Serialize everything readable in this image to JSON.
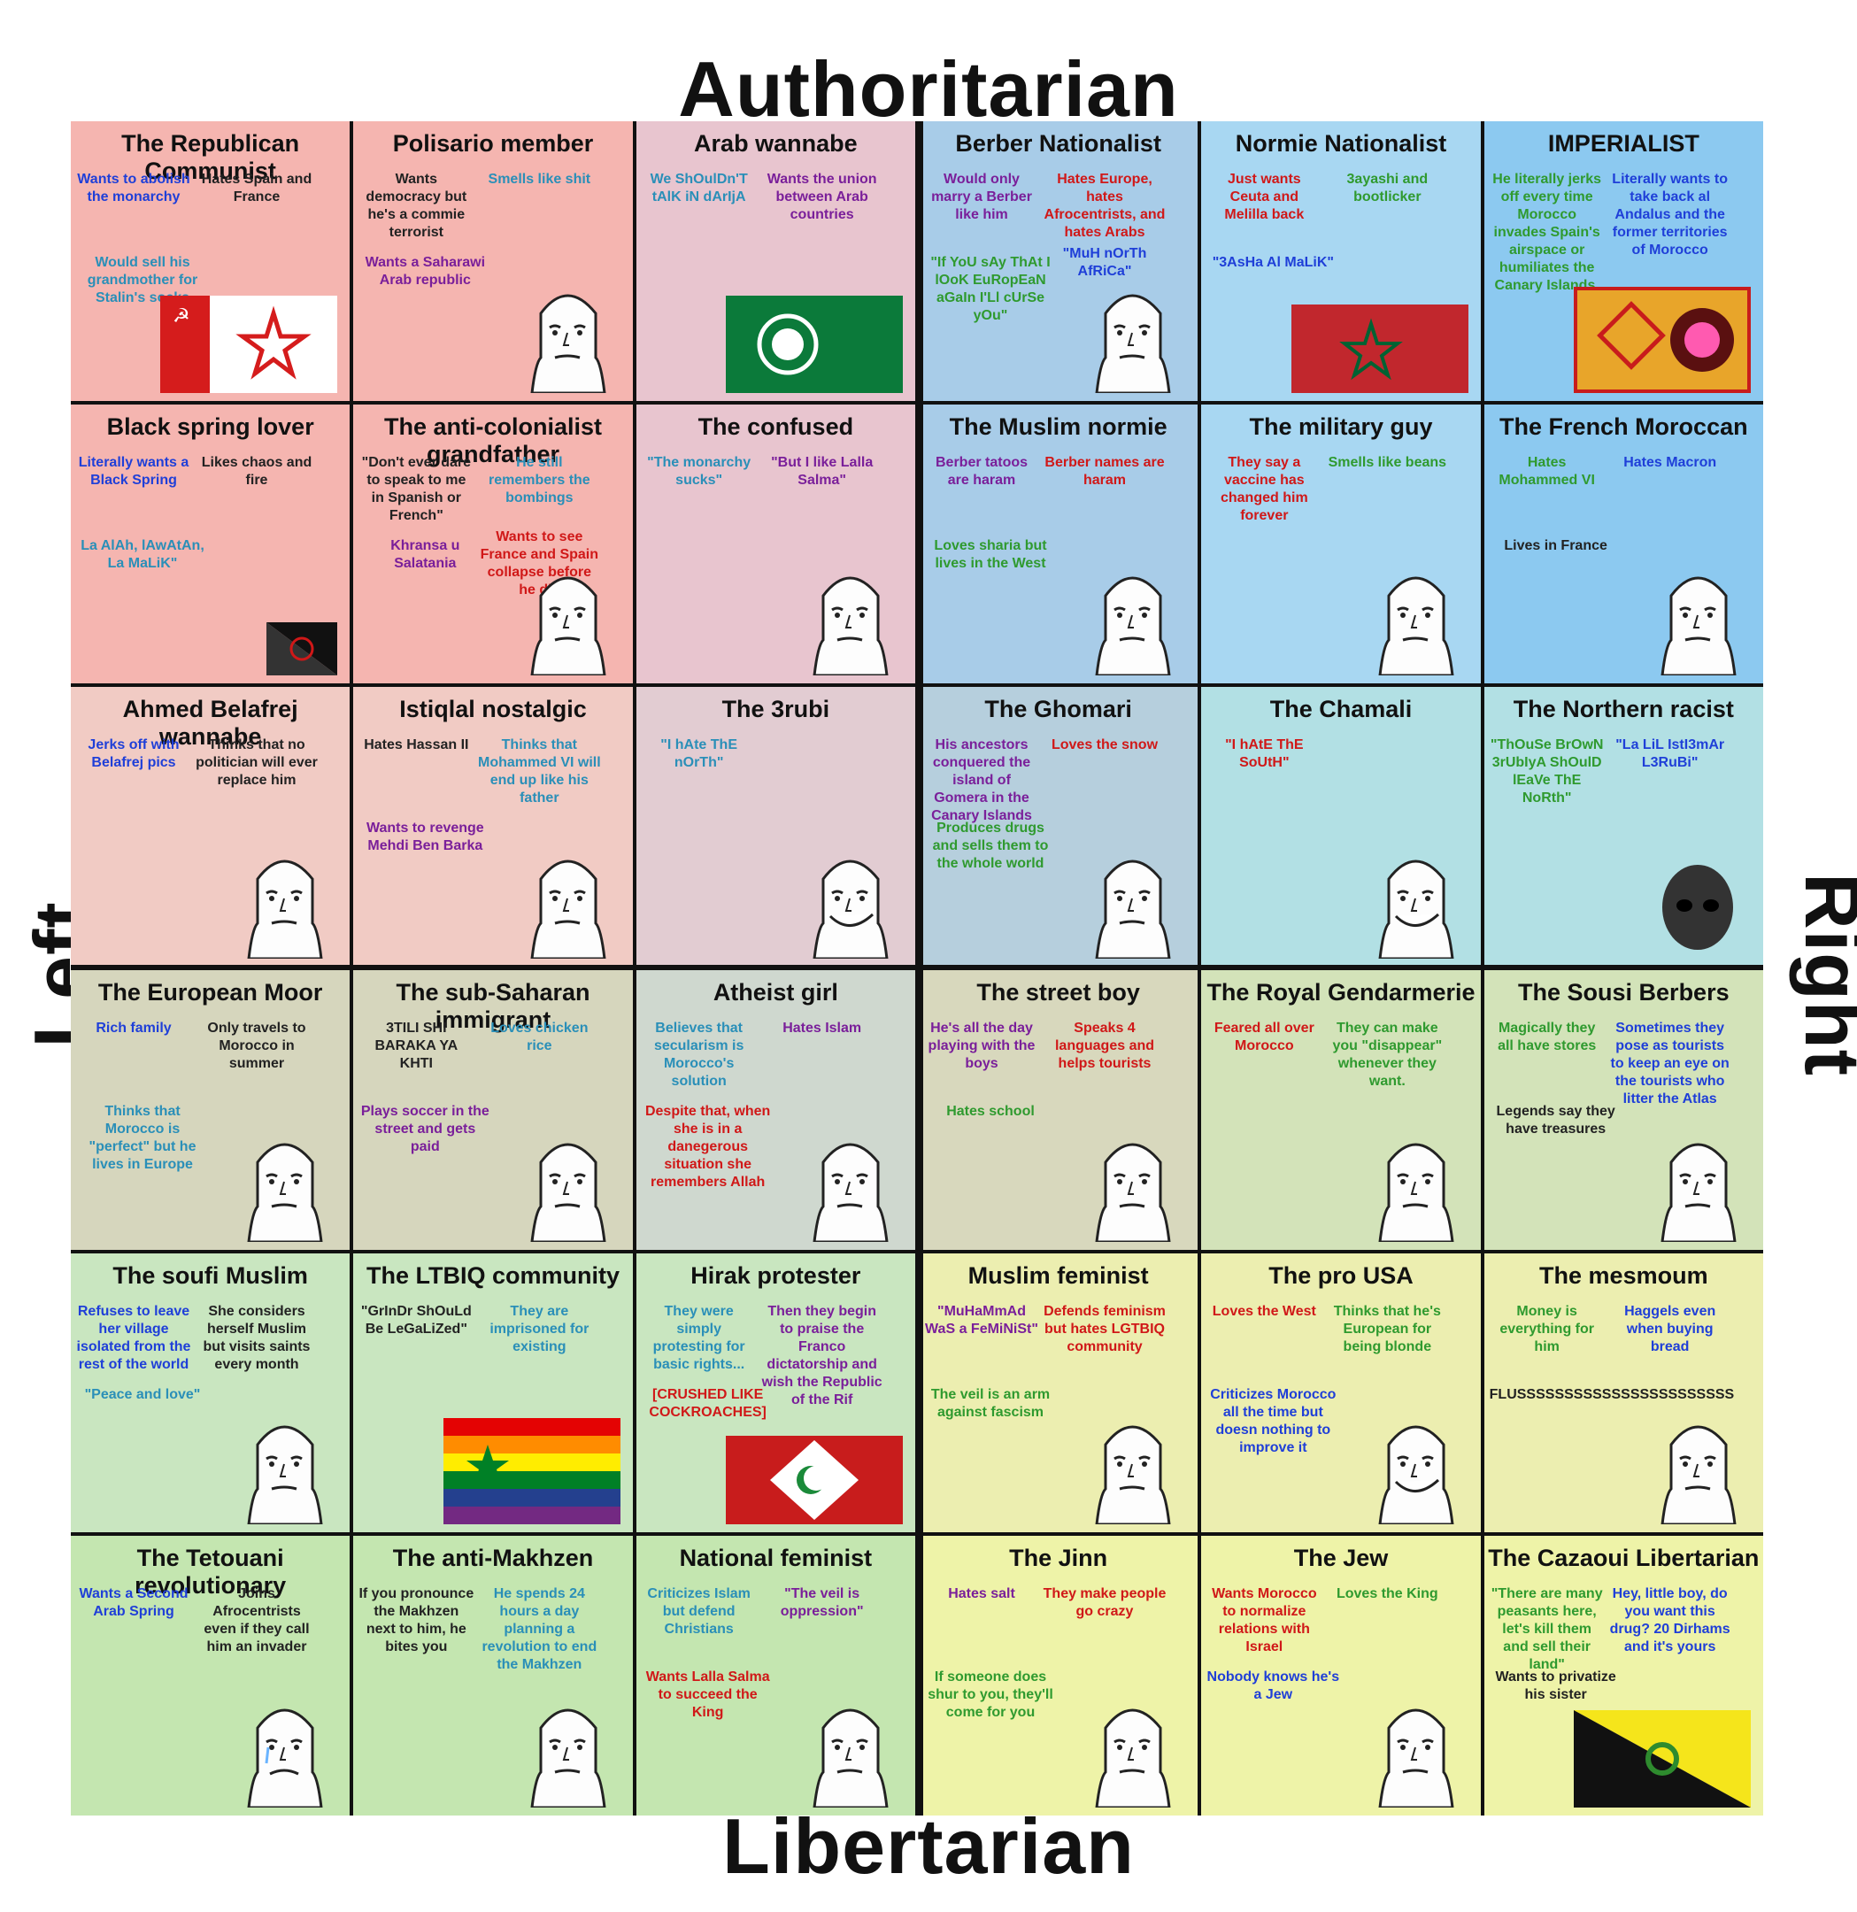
{
  "axes": {
    "top": "Authoritarian",
    "bottom": "Libertarian",
    "left": "Left",
    "right": "Right"
  },
  "colors": {
    "auth_left": "#f4b9b4",
    "auth_right": "#a9d4ee",
    "lib_left": "#c8e6bf",
    "lib_right": "#ecefa6"
  },
  "cells": [
    {
      "title": "The Republican Communist",
      "bg": "#f5b5b0",
      "notes": [
        "Wants to abolish the monarchy",
        "Hates Spain and France",
        "Would sell his grandmother for Stalin's socks"
      ],
      "icon": "communist-flag-icon"
    },
    {
      "title": "Polisario member",
      "bg": "#f5b5b0",
      "notes": [
        "Wants democracy but he's a commie terrorist",
        "Smells like shit",
        "Wants a Saharawi Arab republic"
      ],
      "icon": "militant-icon"
    },
    {
      "title": "Arab wannabe",
      "bg": "#e8c5cf",
      "notes": [
        "We ShOulDn'T tAlK iN dArIjA",
        "Wants the union between Arab countries"
      ],
      "icon": "arab-league-flag-icon"
    },
    {
      "title": "Berber Nationalist",
      "bg": "#a8cce8",
      "notes": [
        "Would only marry a Berber like him",
        "Hates Europe, hates Afrocentrists, and hates Arabs",
        "\"If YoU sAy ThAt I lOoK EuRopEaN aGaIn I'Ll cUrSe yOu\"",
        "\"MuH nOrTh AfRiCa\""
      ],
      "icon": "soldier-helmet-icon"
    },
    {
      "title": "Normie Nationalist",
      "bg": "#a8d7f2",
      "notes": [
        "Just wants Ceuta and Melilla back",
        "3ayashi and bootlicker",
        "\"3AsHa Al MaLiK\""
      ],
      "icon": "morocco-flag-icon"
    },
    {
      "title": "IMPERIALIST",
      "bg": "#8cc9f0",
      "notes": [
        "He literally jerks off every time Morocco invades Spain's airspace or humiliates the Canary Islands.",
        "Literally wants to take back al Andalus and the former territories of Morocco"
      ],
      "icon": "imperial-flag-icon"
    },
    {
      "title": "Black spring lover",
      "bg": "#f5b5b0",
      "notes": [
        "Literally wants a Black Spring",
        "Likes chaos and fire",
        "La AlAh, lAwAtAn, La MaLiK\""
      ],
      "icon": "anarchy-flag-icon"
    },
    {
      "title": "The anti-colonialist grandfather",
      "bg": "#f5b5b0",
      "notes": [
        "\"Don't ever dare to speak to me in Spanish or French\"",
        "He still remembers the bombings",
        "Khransa u Salatania",
        "Wants to see France and Spain collapse before he die"
      ],
      "icon": "grandfather-icon"
    },
    {
      "title": "The confused",
      "bg": "#e8c5cf",
      "notes": [
        "\"The monarchy sucks\"",
        "\"But I like Lalla Salma\""
      ],
      "icon": "two-faces-icon"
    },
    {
      "title": "The Muslim normie",
      "bg": "#a8cce8",
      "notes": [
        "Berber tatoos are haram",
        "Berber names are haram",
        "Loves sharia but lives in the West"
      ],
      "icon": "soyjak-icon"
    },
    {
      "title": "The military guy",
      "bg": "#a8d7f2",
      "notes": [
        "They say a vaccine has changed him forever",
        "Smells like beans"
      ],
      "icon": "soldier-icon"
    },
    {
      "title": "The French Moroccan",
      "bg": "#8cc9f0",
      "notes": [
        "Hates Mohammed VI",
        "Hates Macron",
        "Lives in France"
      ],
      "icon": "wojak-icon"
    },
    {
      "title": "Ahmed Belafrej wannabe",
      "bg": "#f1cbc4",
      "notes": [
        "Jerks off with Belafrej pics",
        "Thinks that no politician will ever replace him"
      ],
      "icon": "wojak-mask-icon"
    },
    {
      "title": "Istiqlal nostalgic",
      "bg": "#f1cbc4",
      "notes": [
        "Hates Hassan II",
        "Thinks that Mohammed VI will end up like his father",
        "Wants to revenge Mehdi Ben Barka"
      ],
      "icon": "two-wojaks-icon"
    },
    {
      "title": "The 3rubi",
      "bg": "#e2ccd2",
      "notes": [
        "\"I hAte ThE nOrTh\""
      ],
      "icon": "grinning-wojak-icon"
    },
    {
      "title": "The Ghomari",
      "bg": "#b6cfdd",
      "notes": [
        "His ancestors conquered the island of Gomera in the Canary Islands",
        "Loves the snow",
        "Produces drugs and sells them to the whole world"
      ],
      "icon": "sombrero-man-icon"
    },
    {
      "title": "The Chamali",
      "bg": "#b2e0e4",
      "notes": [
        "\"I hAtE ThE SoUtH\""
      ],
      "icon": "grinning-wojak-icon"
    },
    {
      "title": "The Northern racist",
      "bg": "#b2e0e4",
      "notes": [
        "\"ThOuSe BrOwN 3rUbIyA ShOulD lEaVe ThE NoRth\"",
        "\"La LiL IstI3mAr L3RuBi\""
      ],
      "icon": "dark-wojak-icon"
    },
    {
      "title": "The European Moor",
      "bg": "#d6d6bd",
      "notes": [
        "Rich family",
        "Only travels to Morocco in summer",
        "Thinks that Morocco is \"perfect\" but he lives in Europe"
      ],
      "icon": "wojak-icon"
    },
    {
      "title": "The sub-Saharan immigrant",
      "bg": "#d6d6bd",
      "notes": [
        "3TILI SHI BARAKA YA KHTI",
        "Loves chicken rice",
        "Plays soccer in the street and gets paid"
      ],
      "icon": "wojak-icon"
    },
    {
      "title": "Atheist girl",
      "bg": "#cfd8cf",
      "notes": [
        "Believes that secularism is Morocco's solution",
        "Hates Islam",
        "Despite that, when she is in a danegerous situation she remembers Allah"
      ],
      "icon": "girl-icon"
    },
    {
      "title": "The street boy",
      "bg": "#d8d8bd",
      "notes": [
        "He's all the day playing with the boys",
        "Speaks 4 languages and helps tourists",
        "Hates school"
      ],
      "icon": "cap-chad-icon"
    },
    {
      "title": "The Royal Gendarmerie",
      "bg": "#d3e3b9",
      "notes": [
        "Feared all over Morocco",
        "They can make you \"disappear\" whenever they want."
      ],
      "icon": "officer-icon"
    },
    {
      "title": "The Sousi Berbers",
      "bg": "#d3e3b9",
      "notes": [
        "Magically they all have stores",
        "Sometimes they pose as tourists to keep an eye on the tourists who litter the Atlas",
        "Legends say they have treasures"
      ],
      "icon": "man-icon"
    },
    {
      "title": "The soufi Muslim",
      "bg": "#c9e6c0",
      "notes": [
        "Refuses to leave her village isolated from the rest of the world",
        "She considers herself Muslim but visits saints every month",
        "\"Peace and love\""
      ],
      "icon": "woman-icon"
    },
    {
      "title": "The LTBIQ community",
      "bg": "#c9e6c0",
      "notes": [
        "\"GrInDr ShOuLd Be LeGaLiZed\"",
        "They are imprisoned for existing"
      ],
      "icon": "rainbow-flag-icon"
    },
    {
      "title": "Hirak protester",
      "bg": "#c9e6c0",
      "notes": [
        "They were simply protesting for basic rights...",
        "Then they begin to praise the Franco dictatorship and wish the Republic of the Rif",
        "[CRUSHED LIKE COCKROACHES]"
      ],
      "icon": "rif-flag-icon"
    },
    {
      "title": "Muslim feminist",
      "bg": "#eceeb0",
      "notes": [
        "\"MuHaMmAd WaS a FeMiNiSt\"",
        "Defends feminism but hates LGTBIQ community",
        "The veil is an arm against fascism"
      ],
      "icon": "wojak-icon"
    },
    {
      "title": "The pro USA",
      "bg": "#eceeb0",
      "notes": [
        "Loves the West",
        "Thinks that he's European for being blonde",
        "Criticizes Morocco all the time but doesn nothing to improve it"
      ],
      "icon": "smiling-wojak-icon"
    },
    {
      "title": "The mesmoum",
      "bg": "#eceeb0",
      "notes": [
        "Money is everything for him",
        "Haggels even when buying bread",
        "FLUSSSSSSSSSSSSSSSSSSSSSSS"
      ],
      "icon": "wojak-icon"
    },
    {
      "title": "The Tetouani revolutionary",
      "bg": "#c4e6b0",
      "notes": [
        "Wants a Second Arab Spring",
        "Joins Afrocentrists even if they call him an invader"
      ],
      "icon": "crying-wojak-icon"
    },
    {
      "title": "The anti-Makhzen",
      "bg": "#c4e6b0",
      "notes": [
        "If you pronounce the Makhzen next to him, he bites you",
        "He spends 24 hours a day planning a revolution to end the Makhzen"
      ],
      "icon": "thinking-wojak-icon"
    },
    {
      "title": "National feminist",
      "bg": "#c4e6b0",
      "notes": [
        "Criticizes Islam but defend Christians",
        "\"The veil is oppression\"",
        "Wants Lalla Salma to succeed the King"
      ],
      "icon": "blonde-girl-icon"
    },
    {
      "title": "The Jinn",
      "bg": "#eef3a8",
      "notes": [
        "Hates salt",
        "They make people go crazy",
        "If someone does shur to you, they'll come for you"
      ],
      "icon": "blue-faces-icon"
    },
    {
      "title": "The Jew",
      "bg": "#eef3a8",
      "notes": [
        "Wants Morocco to normalize relations with Israel",
        "Loves the King",
        "Nobody knows he's a Jew"
      ],
      "icon": "hat-man-icon"
    },
    {
      "title": "The Cazaoui Libertarian",
      "bg": "#eef3a8",
      "notes": [
        "\"There are many peasants here, let's kill them and sell their land\"",
        "Hey, little boy, do you want this drug? 20 Dirhams and it's yours",
        "Wants to privatize his sister"
      ],
      "icon": "gadsden-flag-icon"
    }
  ]
}
